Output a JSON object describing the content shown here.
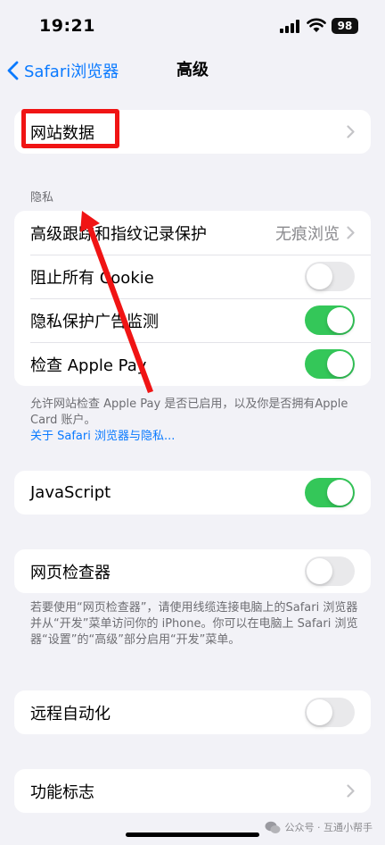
{
  "status_bar": {
    "time": "19:21",
    "battery": "98",
    "icons": [
      "signal-icon",
      "wifi-icon",
      "battery-icon"
    ]
  },
  "nav": {
    "back_label": "Safari浏览器",
    "back_icon": "chevron-left-icon",
    "title": "高级"
  },
  "group_website_data": {
    "label": "网站数据"
  },
  "privacy": {
    "header": "隐私",
    "tracking_label": "高级跟踪和指纹记录保护",
    "tracking_value": "无痕浏览",
    "block_cookies_label": "阻止所有 Cookie",
    "block_cookies_on": false,
    "privacy_ad_label": "隐私保护广告监测",
    "privacy_ad_on": true,
    "apple_pay_label": "检查 Apple Pay",
    "apple_pay_on": true,
    "footer_text": "允许网站检查 Apple Pay 是否已启用，以及你是否拥有Apple Card 账户。",
    "footer_link": "关于 Safari 浏览器与隐私..."
  },
  "javascript": {
    "label": "JavaScript",
    "on": true
  },
  "web_inspector": {
    "label": "网页检查器",
    "on": false,
    "footer_text": "若要使用“网页检查器”，请使用线缆连接电脑上的Safari 浏览器并从“开发”菜单访问你的 iPhone。你可以在电脑上 Safari 浏览器“设置”的“高级”部分启用“开发”菜单。"
  },
  "remote_automation": {
    "label": "远程自动化",
    "on": false
  },
  "feature_flags": {
    "label": "功能标志"
  },
  "watermark": {
    "text": "公众号 · 互通小帮手",
    "icon": "wechat-icon"
  },
  "colors": {
    "accent": "#0a7aff",
    "toggle_on": "#34c759",
    "annotation": "#f01414",
    "background": "#f2f2f7"
  }
}
